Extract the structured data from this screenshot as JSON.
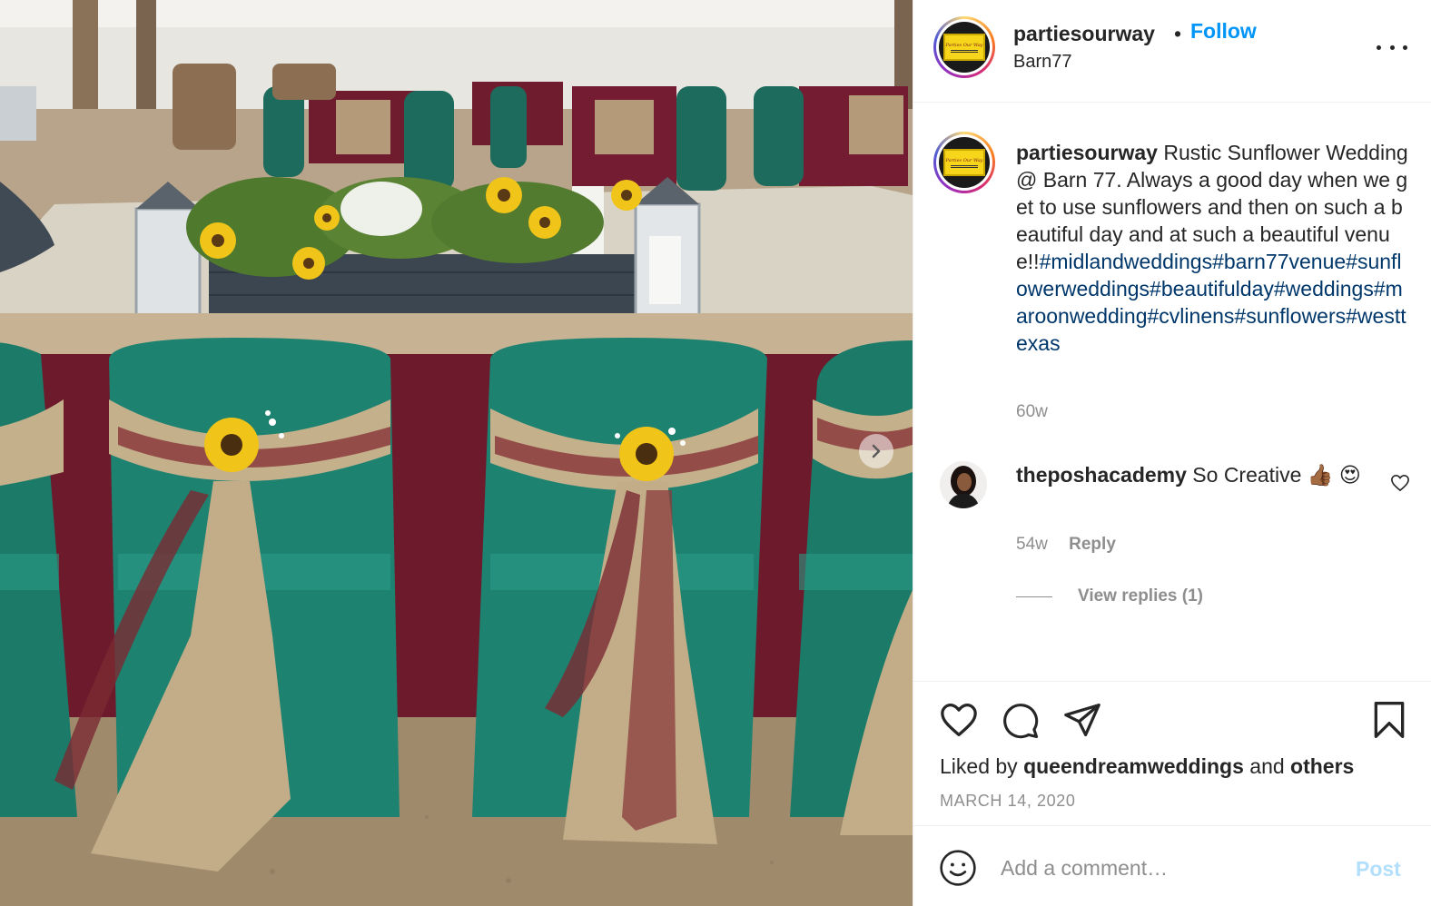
{
  "post": {
    "username": "partiesourway",
    "dot": "•",
    "follow_label": "Follow",
    "location": "Barn77",
    "caption": {
      "username": "partiesourway",
      "text": "Rustic Sunflower Wedding @ Barn 77. Always a good day when we get to use sunflowers and then on such a beautiful day and at such a beautiful venue!!",
      "hashtags": [
        "#midlandweddings",
        "#barn77venue",
        "#sunflowerweddings",
        "#beautifulday",
        "#weddings",
        "#maroonwedding",
        "#cvlinens",
        "#sunflowers",
        "#westtexas"
      ],
      "time": "60w"
    },
    "comments": [
      {
        "username": "theposhacademy",
        "text": "So Creative 👍🏾 😍",
        "time": "54w",
        "reply_label": "Reply",
        "view_replies_label": "View replies (1)"
      }
    ],
    "liked_by": {
      "prefix": "Liked by",
      "user": "queendreamweddings",
      "conjunction": "and",
      "others": "others"
    },
    "date": "MARCH 14, 2020",
    "add_comment": {
      "placeholder": "Add a comment…",
      "post_label": "Post"
    },
    "logo_text": "Parties Our Way"
  },
  "colors": {
    "follow": "#0095f6",
    "hashtag": "#00376b",
    "secondary_text": "#8e8e8e",
    "post_disabled": "#b2dffc"
  }
}
